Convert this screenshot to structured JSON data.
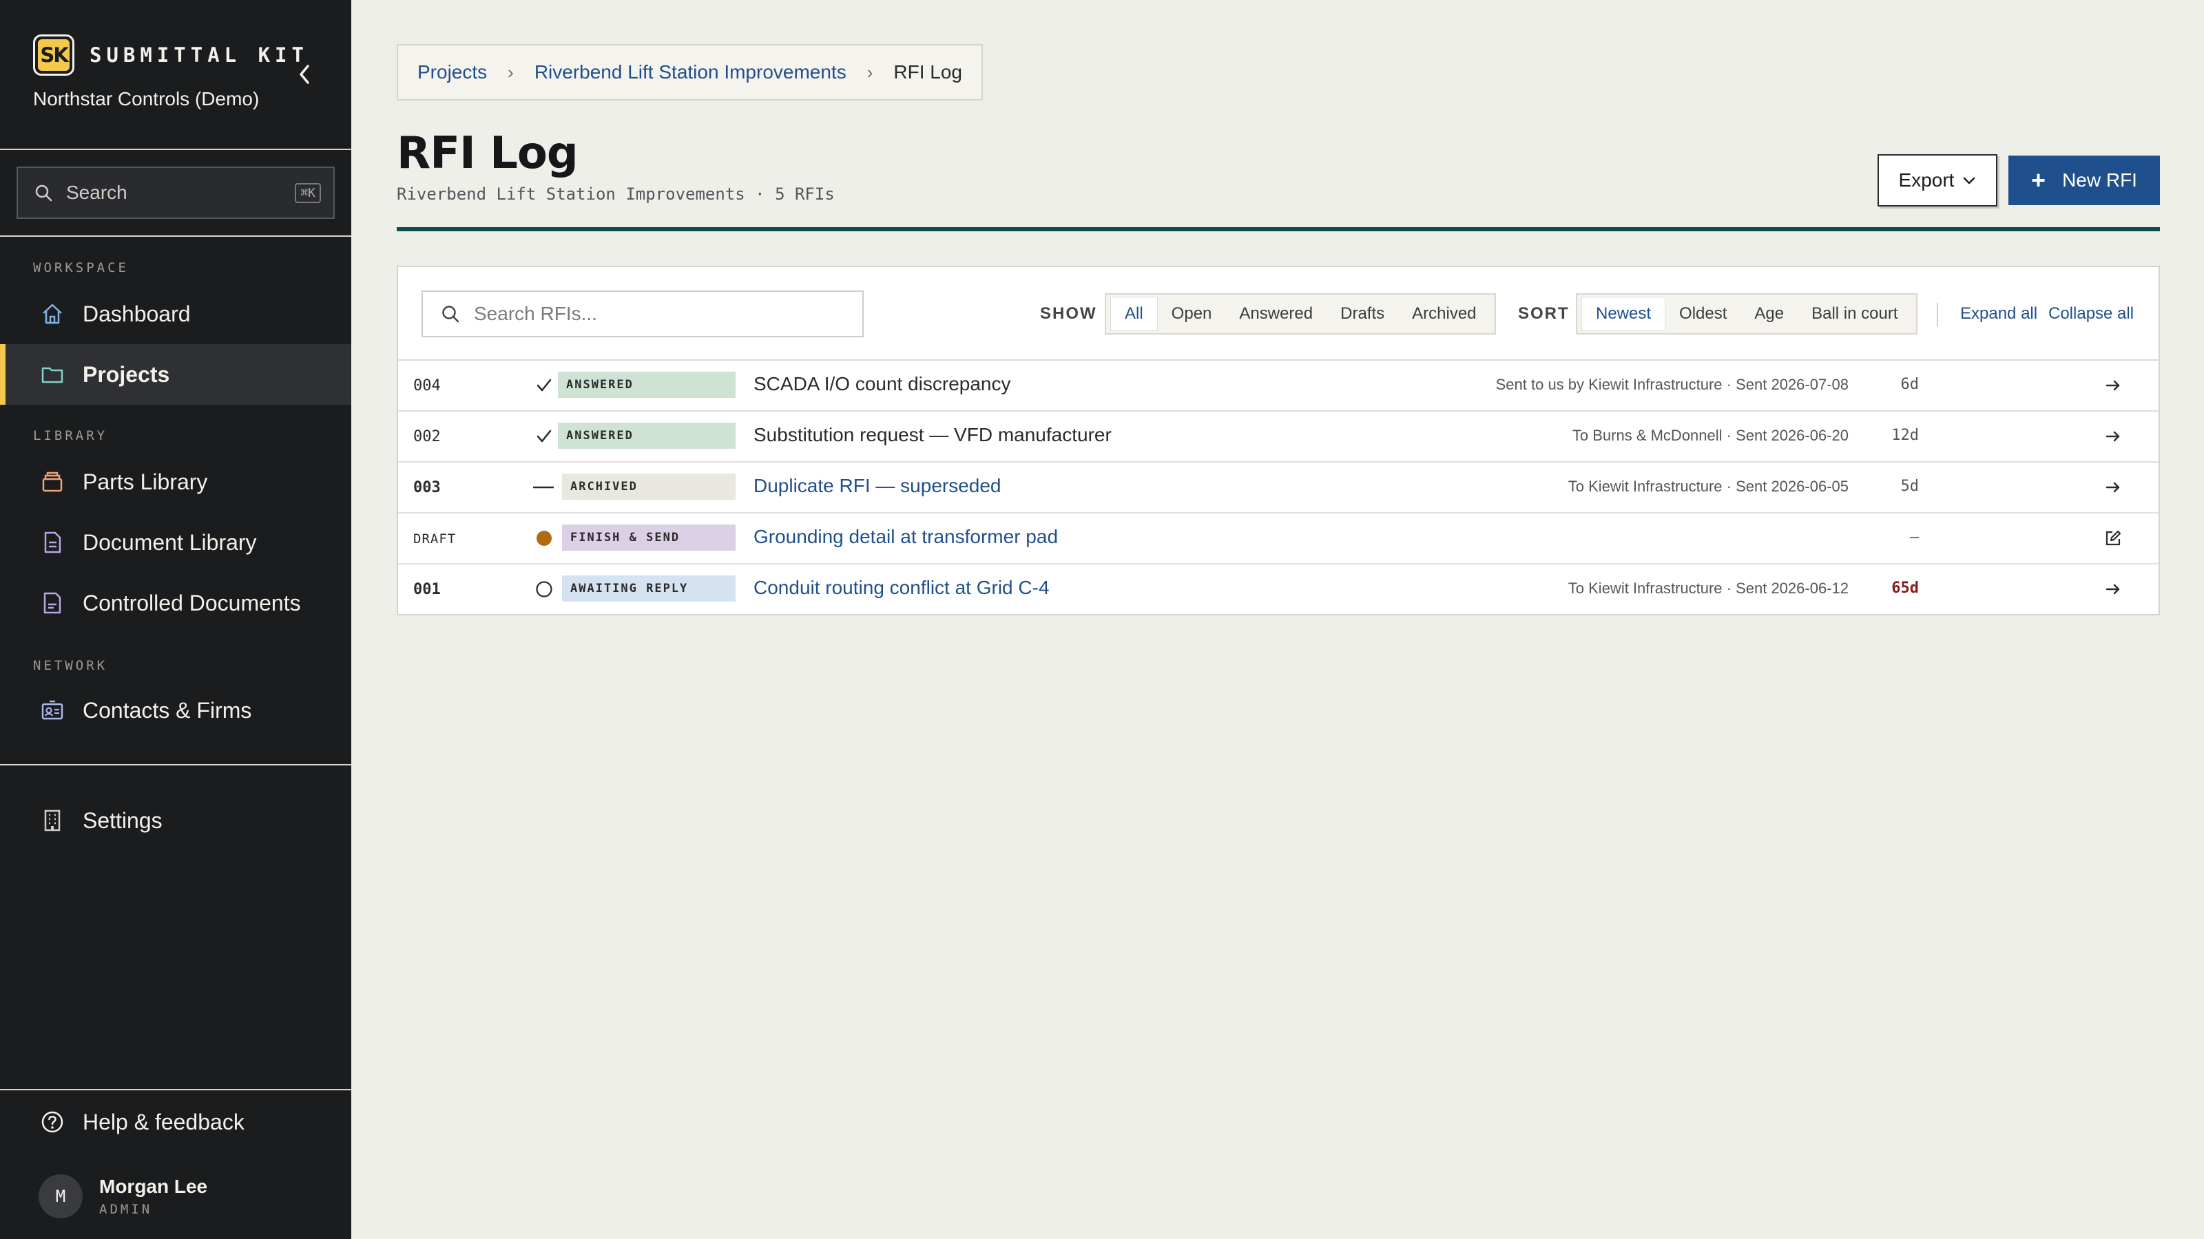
{
  "app": {
    "logo_text": "SK",
    "name": "SUBMITTAL KIT",
    "org": "Northstar Controls (Demo)"
  },
  "sidebar": {
    "search_label": "Search",
    "search_shortcut": "⌘K",
    "sections": {
      "workspace": "WORKSPACE",
      "library": "LIBRARY",
      "network": "NETWORK"
    },
    "items": [
      {
        "label": "Dashboard",
        "icon": "home-icon",
        "active": false
      },
      {
        "label": "Projects",
        "icon": "folder-icon",
        "active": true
      },
      {
        "label": "Parts Library",
        "icon": "box-icon",
        "active": false
      },
      {
        "label": "Document Library",
        "icon": "document-icon",
        "active": false
      },
      {
        "label": "Controlled Documents",
        "icon": "controlled-document-icon",
        "active": false
      },
      {
        "label": "Contacts & Firms",
        "icon": "contact-card-icon",
        "active": false
      },
      {
        "label": "Settings",
        "icon": "building-icon",
        "active": false
      }
    ],
    "help": "Help & feedback",
    "user": {
      "initial": "M",
      "name": "Morgan Lee",
      "role": "ADMIN"
    }
  },
  "breadcrumb": {
    "root": "Projects",
    "project": "Riverbend Lift Station Improvements",
    "current": "RFI Log"
  },
  "header": {
    "title": "RFI Log",
    "subtitle": "Riverbend Lift Station Improvements · 5 RFIs",
    "export_label": "Export",
    "new_label": "New RFI"
  },
  "filters": {
    "search_placeholder": "Search RFIs...",
    "show_label": "SHOW",
    "show_options": [
      "All",
      "Open",
      "Answered",
      "Drafts",
      "Archived"
    ],
    "show_selected": "All",
    "sort_label": "SORT",
    "sort_options": [
      "Newest",
      "Oldest",
      "Age",
      "Ball in court"
    ],
    "sort_selected": "Newest",
    "expand_all": "Expand all",
    "collapse_all": "Collapse all"
  },
  "rfis": [
    {
      "number": "004",
      "status": "ANSWERED",
      "status_icon": "check-icon",
      "title": "SCADA I/O count discrepancy",
      "meta": "Sent to us by Kiewit Infrastructure · Sent 2026-07-08",
      "age": "6d",
      "action_icon": "arrow-right-icon"
    },
    {
      "number": "002",
      "status": "ANSWERED",
      "status_icon": "check-icon",
      "title": "Substitution request — VFD manufacturer",
      "meta": "To Burns & McDonnell · Sent 2026-06-20",
      "age": "12d",
      "action_icon": "arrow-right-icon"
    },
    {
      "number": "003",
      "status": "ARCHIVED",
      "status_icon": "dash-icon",
      "title": "Duplicate RFI — superseded",
      "meta": "To Kiewit Infrastructure · Sent 2026-06-05",
      "age": "5d",
      "action_icon": "arrow-right-icon"
    },
    {
      "number": "DRAFT",
      "status": "FINISH & SEND",
      "status_icon": "filled-dot-icon",
      "title": "Grounding detail at transformer pad",
      "meta": "",
      "age": "–",
      "action_icon": "edit-icon"
    },
    {
      "number": "001",
      "status": "AWAITING REPLY",
      "status_icon": "open-circle-icon",
      "title": "Conduit routing conflict at Grid C-4",
      "meta": "To Kiewit Infrastructure · Sent 2026-06-12",
      "age": "65d",
      "action_icon": "arrow-right-icon"
    }
  ],
  "colors": {
    "accent": "#1f4f8c",
    "brand_yellow": "#f2c94c",
    "rule_teal": "#0e4f4a",
    "answered_bg": "#cfe3d4",
    "archived_bg": "#e8e7e0",
    "draft_bg": "#dcd0e6",
    "awaiting_bg": "#d4e2f1",
    "draft_dot": "#b06a10",
    "overdue": "#8b1a1a"
  }
}
